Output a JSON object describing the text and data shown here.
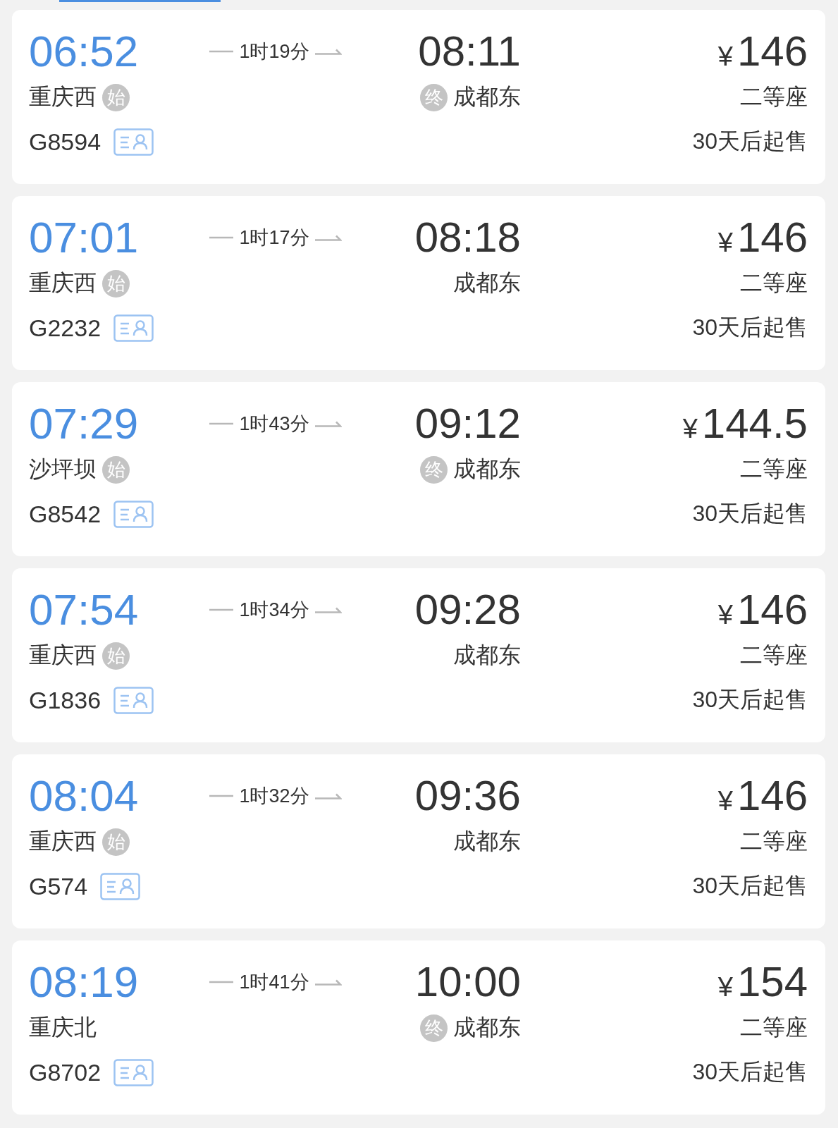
{
  "trains": [
    {
      "depart_time": "06:52",
      "duration": "1时19分",
      "arrive_time": "08:11",
      "currency": "¥",
      "price": "146",
      "from_station": "重庆西",
      "from_badge": "始",
      "to_badge": "终",
      "to_station": "成都东",
      "seat_class": "二等座",
      "train_no": "G8594",
      "sale_status": "30天后起售"
    },
    {
      "depart_time": "07:01",
      "duration": "1时17分",
      "arrive_time": "08:18",
      "currency": "¥",
      "price": "146",
      "from_station": "重庆西",
      "from_badge": "始",
      "to_station": "成都东",
      "seat_class": "二等座",
      "train_no": "G2232",
      "sale_status": "30天后起售"
    },
    {
      "depart_time": "07:29",
      "duration": "1时43分",
      "arrive_time": "09:12",
      "currency": "¥",
      "price": "144.5",
      "from_station": "沙坪坝",
      "from_badge": "始",
      "to_badge": "终",
      "to_station": "成都东",
      "seat_class": "二等座",
      "train_no": "G8542",
      "sale_status": "30天后起售"
    },
    {
      "depart_time": "07:54",
      "duration": "1时34分",
      "arrive_time": "09:28",
      "currency": "¥",
      "price": "146",
      "from_station": "重庆西",
      "from_badge": "始",
      "to_station": "成都东",
      "seat_class": "二等座",
      "train_no": "G1836",
      "sale_status": "30天后起售"
    },
    {
      "depart_time": "08:04",
      "duration": "1时32分",
      "arrive_time": "09:36",
      "currency": "¥",
      "price": "146",
      "from_station": "重庆西",
      "from_badge": "始",
      "to_station": "成都东",
      "seat_class": "二等座",
      "train_no": "G574",
      "sale_status": "30天后起售"
    },
    {
      "depart_time": "08:19",
      "duration": "1时41分",
      "arrive_time": "10:00",
      "currency": "¥",
      "price": "154",
      "from_station": "重庆北",
      "to_badge": "终",
      "to_station": "成都东",
      "seat_class": "二等座",
      "train_no": "G8702",
      "sale_status": "30天后起售"
    }
  ]
}
